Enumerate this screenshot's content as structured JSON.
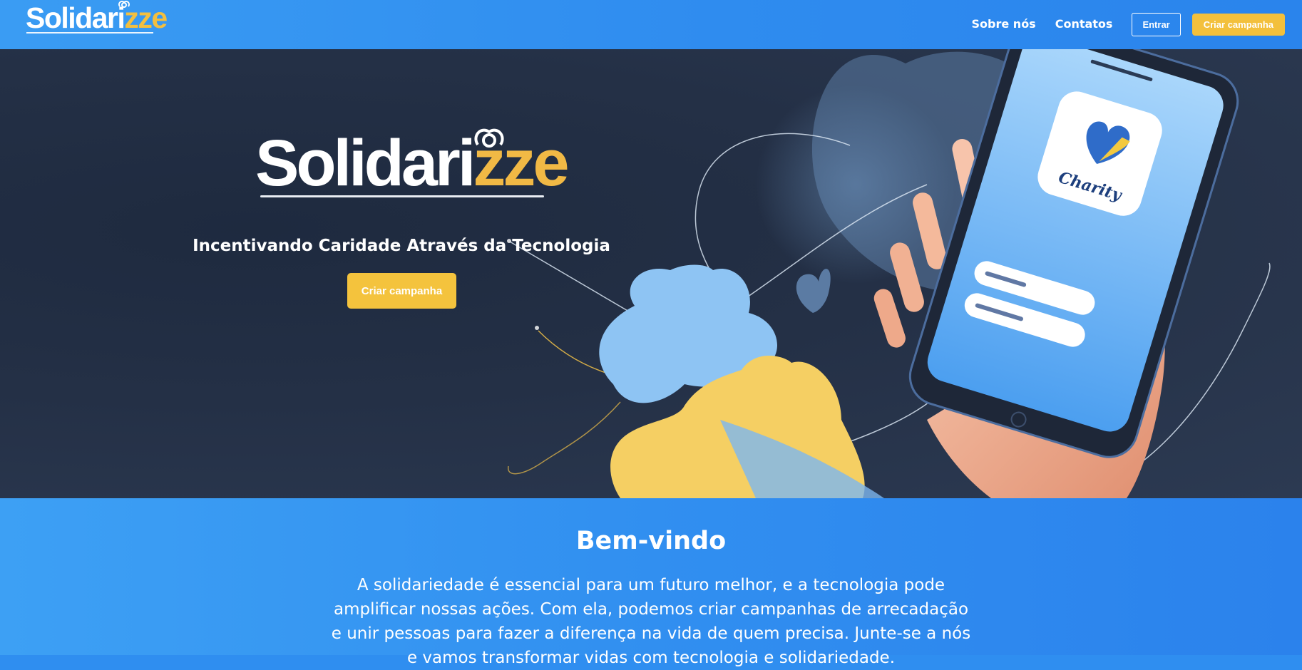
{
  "header": {
    "brand_main": "Solidari",
    "brand_accent": "zze",
    "nav": {
      "about": "Sobre nós",
      "contacts": "Contatos",
      "login": "Entrar",
      "create_campaign": "Criar campanha"
    }
  },
  "hero": {
    "logo_main": "Solidari",
    "logo_accent": "zze",
    "tagline": "Incentivando Caridade Através da Tecnologia",
    "cta": "Criar campanha",
    "phone_app_label": "Charity",
    "icons": [
      "heart-icon",
      "phone-illustration",
      "hand-illustration"
    ]
  },
  "welcome": {
    "title": "Bem-vindo",
    "text": "A solidariedade é essencial para um futuro melhor, e a tecnologia pode amplificar nossas ações. Com ela, podemos criar campanhas de arrecadação e unir pessoas para fazer a diferença na vida de quem precisa. Junte-se a nós e vamos transformar vidas com tecnologia e solidariedade."
  },
  "colors": {
    "brand_blue": "#2f8cef",
    "accent_yellow": "#f3c03c",
    "hero_dark": "#243046"
  }
}
